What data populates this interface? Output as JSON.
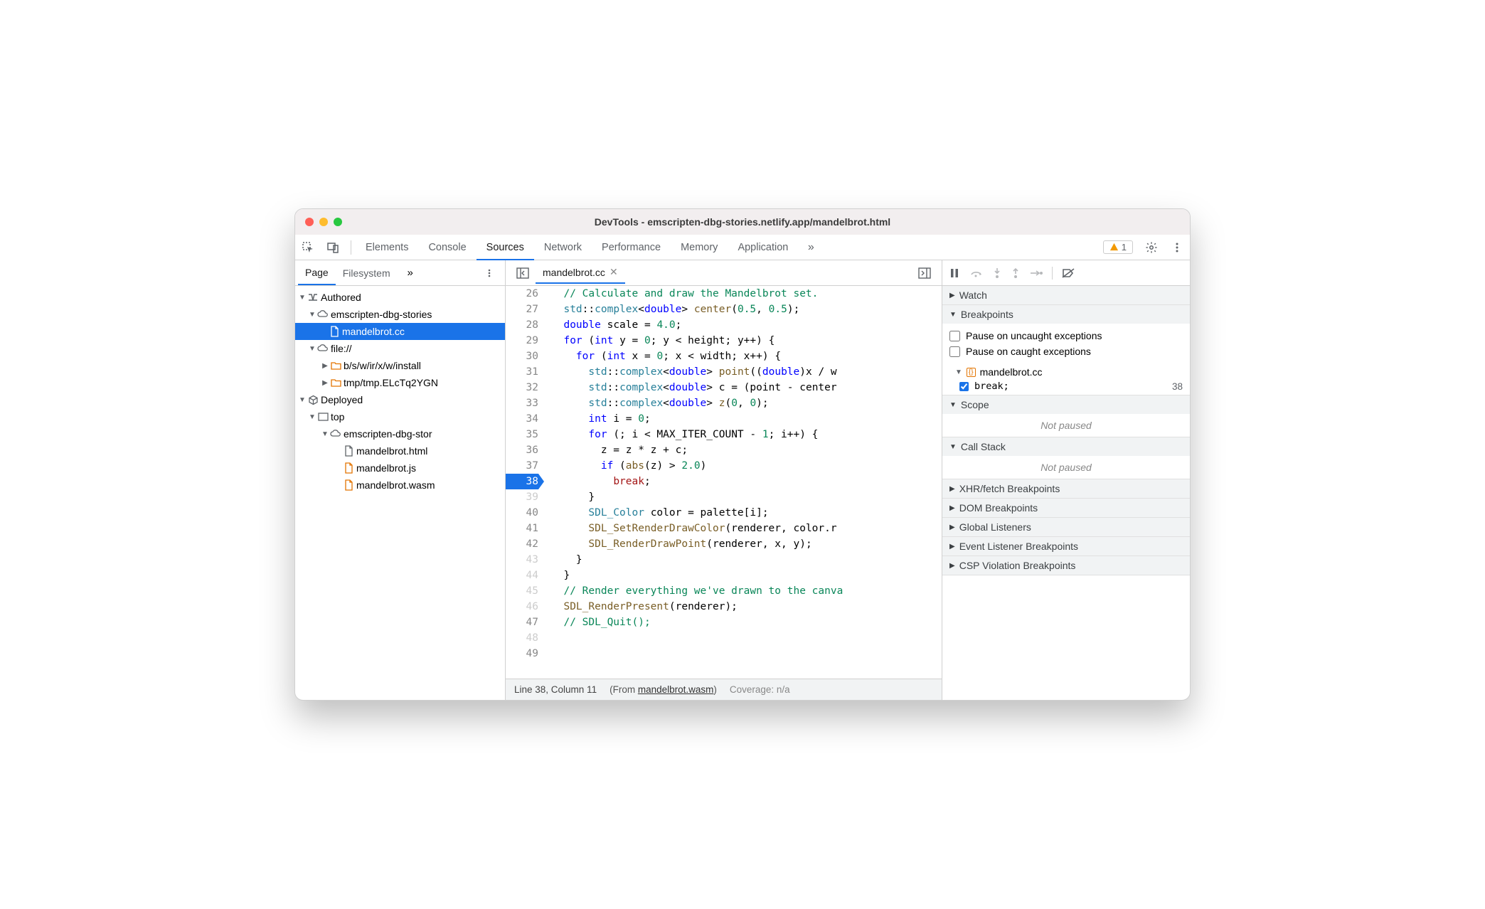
{
  "title": "DevTools - emscripten-dbg-stories.netlify.app/mandelbrot.html",
  "tabs": [
    "Elements",
    "Console",
    "Sources",
    "Network",
    "Performance",
    "Memory",
    "Application"
  ],
  "activeTab": "Sources",
  "warn_count": "1",
  "nav": {
    "tabs": [
      "Page",
      "Filesystem"
    ],
    "active": "Page"
  },
  "tree": {
    "authored": "Authored",
    "host1": "emscripten-dbg-stories",
    "file1": "mandelbrot.cc",
    "file_scheme": "file://",
    "folder1": "b/s/w/ir/x/w/install",
    "folder2": "tmp/tmp.ELcTq2YGN",
    "deployed": "Deployed",
    "top": "top",
    "host2": "emscripten-dbg-stor",
    "f_html": "mandelbrot.html",
    "f_js": "mandelbrot.js",
    "f_wasm": "mandelbrot.wasm"
  },
  "editor": {
    "filename": "mandelbrot.cc",
    "firstLine": 26,
    "bpLine": 38,
    "grayLines": [
      39,
      43,
      44,
      45,
      46,
      48
    ],
    "lines": [
      [
        [
          "  "
        ],
        [
          "// Calculate and draw the Mandelbrot set.",
          "c-cm"
        ]
      ],
      [
        [
          "  "
        ],
        [
          "std",
          "c-ty"
        ],
        [
          "::"
        ],
        [
          "complex",
          "c-ty"
        ],
        [
          "<"
        ],
        [
          "double",
          "c-kw"
        ],
        [
          "> "
        ],
        [
          "center",
          "c-fn"
        ],
        [
          "("
        ],
        [
          "0.5",
          "c-nm"
        ],
        [
          ", "
        ],
        [
          "0.5",
          "c-nm"
        ],
        [
          ");"
        ]
      ],
      [
        [
          "  "
        ],
        [
          "double",
          "c-kw"
        ],
        [
          " scale = "
        ],
        [
          "4.0",
          "c-nm"
        ],
        [
          ";"
        ]
      ],
      [
        [
          "  "
        ],
        [
          "for",
          "c-kw"
        ],
        [
          " ("
        ],
        [
          "int",
          "c-kw"
        ],
        [
          " y = "
        ],
        [
          "0",
          "c-nm"
        ],
        [
          "; y < height; y++) {"
        ]
      ],
      [
        [
          "    "
        ],
        [
          "for",
          "c-kw"
        ],
        [
          " ("
        ],
        [
          "int",
          "c-kw"
        ],
        [
          " x = "
        ],
        [
          "0",
          "c-nm"
        ],
        [
          "; x < width; x++) {"
        ]
      ],
      [
        [
          "      "
        ],
        [
          "std",
          "c-ty"
        ],
        [
          "::"
        ],
        [
          "complex",
          "c-ty"
        ],
        [
          "<"
        ],
        [
          "double",
          "c-kw"
        ],
        [
          "> "
        ],
        [
          "point",
          "c-fn"
        ],
        [
          "(("
        ],
        [
          "double",
          "c-kw"
        ],
        [
          ")x / w"
        ]
      ],
      [
        [
          "      "
        ],
        [
          "std",
          "c-ty"
        ],
        [
          "::"
        ],
        [
          "complex",
          "c-ty"
        ],
        [
          "<"
        ],
        [
          "double",
          "c-kw"
        ],
        [
          "> c = (point - center"
        ]
      ],
      [
        [
          "      "
        ],
        [
          "std",
          "c-ty"
        ],
        [
          "::"
        ],
        [
          "complex",
          "c-ty"
        ],
        [
          "<"
        ],
        [
          "double",
          "c-kw"
        ],
        [
          "> "
        ],
        [
          "z",
          "c-fn"
        ],
        [
          "("
        ],
        [
          "0",
          "c-nm"
        ],
        [
          ", "
        ],
        [
          "0",
          "c-nm"
        ],
        [
          ");"
        ]
      ],
      [
        [
          "      "
        ],
        [
          "int",
          "c-kw"
        ],
        [
          " i = "
        ],
        [
          "0",
          "c-nm"
        ],
        [
          ";"
        ]
      ],
      [
        [
          "      "
        ],
        [
          "for",
          "c-kw"
        ],
        [
          " (; i < MAX_ITER_COUNT - "
        ],
        [
          "1",
          "c-nm"
        ],
        [
          "; i++) {"
        ]
      ],
      [
        [
          "        z = z * z + c;"
        ]
      ],
      [
        [
          "        "
        ],
        [
          "if",
          "c-kw"
        ],
        [
          " ("
        ],
        [
          "abs",
          "c-fn"
        ],
        [
          "(z) > "
        ],
        [
          "2.0",
          "c-nm"
        ],
        [
          ")"
        ]
      ],
      [
        [
          "          "
        ],
        [
          "break",
          "c-st"
        ],
        [
          ";"
        ]
      ],
      [
        [
          "      }"
        ]
      ],
      [
        [
          "      "
        ],
        [
          "SDL_Color",
          "c-ty"
        ],
        [
          " color = palette[i];"
        ]
      ],
      [
        [
          "      "
        ],
        [
          "SDL_SetRenderDrawColor",
          "c-fn"
        ],
        [
          "(renderer, color.r"
        ]
      ],
      [
        [
          "      "
        ],
        [
          "SDL_RenderDrawPoint",
          "c-fn"
        ],
        [
          "(renderer, x, y);"
        ]
      ],
      [
        [
          "    }"
        ]
      ],
      [
        [
          "  }"
        ]
      ],
      [
        [
          ""
        ]
      ],
      [
        [
          "  "
        ],
        [
          "// Render everything we've drawn to the canva",
          "c-cm"
        ]
      ],
      [
        [
          "  "
        ],
        [
          "SDL_RenderPresent",
          "c-fn"
        ],
        [
          "(renderer);"
        ]
      ],
      [
        [
          ""
        ]
      ],
      [
        [
          "  "
        ],
        [
          "// SDL_Quit();",
          "c-cm"
        ]
      ]
    ]
  },
  "status": {
    "pos": "Line 38, Column 11",
    "from_label": "(From ",
    "from_file": "mandelbrot.wasm",
    "from_close": ")",
    "coverage": "Coverage: n/a"
  },
  "debug": {
    "watch": "Watch",
    "breakpoints": "Breakpoints",
    "uncaught": "Pause on uncaught exceptions",
    "caught": "Pause on caught exceptions",
    "bpfile": "mandelbrot.cc",
    "bptext": "break;",
    "bpline": "38",
    "scope": "Scope",
    "callstack": "Call Stack",
    "notpaused": "Not paused",
    "xhr": "XHR/fetch Breakpoints",
    "dom": "DOM Breakpoints",
    "gl": "Global Listeners",
    "el": "Event Listener Breakpoints",
    "csp": "CSP Violation Breakpoints"
  }
}
